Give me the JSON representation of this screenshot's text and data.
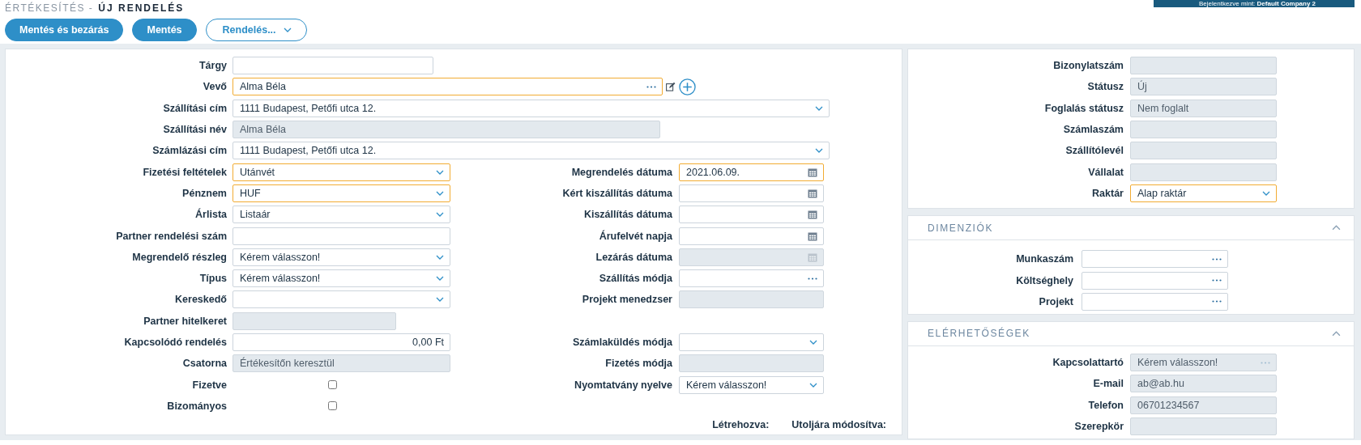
{
  "header": {
    "breadcrumb": "ÉRTÉKESÍTÉS -",
    "title": "ÚJ RENDELÉS",
    "login_banner": "Bejelentkezve mint: **Default Company 2**"
  },
  "buttons": [
    {
      "label": "Mentés és bezárás",
      "kind": "primary"
    },
    {
      "label": "Mentés",
      "kind": "primary"
    },
    {
      "label": "Rendelés...",
      "kind": "menu"
    }
  ],
  "order_form": {
    "top_fields": [
      {
        "label": "Tárgy",
        "kind": "text",
        "disabled": false,
        "highlighted": false,
        "extra_actions": false
      },
      {
        "label": "Vevő",
        "kind": "lookup",
        "value": "Alma Béla",
        "disabled": false,
        "highlighted": true,
        "extra_actions": true
      },
      {
        "label": "Szállítási cím",
        "kind": "select",
        "value": "1111 Budapest, Petőfi utca 12.",
        "disabled": false,
        "highlighted": false,
        "extra_actions": false
      },
      {
        "label": "Szállítási név",
        "kind": "text",
        "value": "Alma Béla",
        "disabled": true,
        "highlighted": false,
        "extra_actions": false
      },
      {
        "label": "Számlázási cím",
        "kind": "select",
        "value": "1111 Budapest, Petőfi utca 12.",
        "disabled": false,
        "highlighted": false,
        "extra_actions": false
      }
    ],
    "rows": [
      {
        "left": {
          "label": "Fizetési feltételek",
          "kind": "select",
          "value": "Utánvét",
          "disabled": false,
          "highlighted": true
        },
        "right": {
          "label": "Megrendelés dátuma",
          "kind": "date",
          "value": "2021.06.09.",
          "disabled": false,
          "highlighted": true
        }
      },
      {
        "left": {
          "label": "Pénznem",
          "kind": "select",
          "value": "HUF",
          "disabled": false,
          "highlighted": true
        },
        "right": {
          "label": "Kért kiszállítás dátuma",
          "kind": "date",
          "disabled": false,
          "highlighted": false
        }
      },
      {
        "left": {
          "label": "Árlista",
          "kind": "select",
          "value": "Listaár",
          "disabled": false,
          "highlighted": false
        },
        "right": {
          "label": "Kiszállítás dátuma",
          "kind": "date",
          "disabled": false,
          "highlighted": false
        }
      },
      {
        "left": {
          "label": "Partner rendelési szám",
          "kind": "text",
          "disabled": false,
          "highlighted": false
        },
        "right": {
          "label": "Árufelvét napja",
          "kind": "date",
          "disabled": false,
          "highlighted": false
        }
      },
      {
        "left": {
          "label": "Megrendelő részleg",
          "kind": "select",
          "value": "Kérem válasszon!",
          "disabled": false,
          "highlighted": false
        },
        "right": {
          "label": "Lezárás dátuma",
          "kind": "date",
          "disabled": true,
          "highlighted": false
        }
      },
      {
        "left": {
          "label": "Típus",
          "kind": "select",
          "value": "Kérem válasszon!",
          "disabled": false,
          "highlighted": false
        },
        "right": {
          "label": "Szállítás módja",
          "kind": "lookup",
          "disabled": false,
          "highlighted": false
        }
      },
      {
        "left": {
          "label": "Kereskedő",
          "kind": "select",
          "disabled": false,
          "highlighted": false
        },
        "right": {
          "label": "Projekt menedzser",
          "kind": "text",
          "disabled": true,
          "highlighted": false
        }
      },
      {
        "left": {
          "label": "Partner hitelkeret",
          "kind": "short",
          "disabled": true,
          "highlighted": false
        }
      },
      {
        "left": {
          "label": "Kapcsolódó rendelés",
          "kind": "amount",
          "value": "0,00 Ft",
          "disabled": false,
          "highlighted": false
        },
        "right": {
          "label": "Számlaküldés módja",
          "kind": "select",
          "disabled": false,
          "highlighted": false
        }
      },
      {
        "left": {
          "label": "Csatorna",
          "kind": "text",
          "value": "Értékesítőn keresztül",
          "disabled": true,
          "highlighted": false
        },
        "right": {
          "label": "Fizetés módja",
          "kind": "text",
          "disabled": true,
          "highlighted": false
        }
      },
      {
        "left": {
          "label": "Fizetve",
          "kind": "checkbox",
          "checked": false,
          "disabled": false,
          "highlighted": false
        },
        "right": {
          "label": "Nyomtatvány nyelve",
          "kind": "select",
          "value": "Kérem válasszon!",
          "disabled": false,
          "highlighted": false
        }
      },
      {
        "left": {
          "label": "Bizományos",
          "kind": "checkbox",
          "checked": false,
          "disabled": false,
          "highlighted": false
        }
      }
    ],
    "footer": [
      "Létrehozva:",
      "Utoljára módosítva:"
    ]
  },
  "document_panel": {
    "fields": [
      {
        "label": "Bizonylatszám",
        "kind": "text",
        "disabled": true,
        "highlighted": false
      },
      {
        "label": "Státusz",
        "kind": "text",
        "value": "Új",
        "disabled": true,
        "highlighted": false
      },
      {
        "label": "Foglalás státusz",
        "kind": "text",
        "value": "Nem foglalt",
        "disabled": true,
        "highlighted": false
      },
      {
        "label": "Számlaszám",
        "kind": "text",
        "disabled": true,
        "highlighted": false
      },
      {
        "label": "Szállítólevél",
        "kind": "text",
        "disabled": true,
        "highlighted": false
      },
      {
        "label": "Vállalat",
        "kind": "text",
        "disabled": true,
        "highlighted": false
      },
      {
        "label": "Raktár",
        "kind": "select",
        "value": "Alap raktár",
        "disabled": false,
        "highlighted": true
      }
    ]
  },
  "sections": [
    {
      "title": "DIMENZIÓK",
      "expanded": true,
      "fields": [
        {
          "label": "Munkaszám",
          "kind": "lookup",
          "disabled": false,
          "highlighted": false
        },
        {
          "label": "Költséghely",
          "kind": "lookup",
          "disabled": false,
          "highlighted": false
        },
        {
          "label": "Projekt",
          "kind": "lookup",
          "disabled": false,
          "highlighted": false
        }
      ]
    },
    {
      "title": "ELÉRHETŐSÉGEK",
      "expanded": true,
      "fields": [
        {
          "label": "Kapcsolattartó",
          "kind": "lookup",
          "value": "Kérem válasszon!",
          "disabled": true,
          "highlighted": false
        },
        {
          "label": "E-mail",
          "kind": "text",
          "value": "ab@ab.hu",
          "disabled": true,
          "highlighted": false
        },
        {
          "label": "Telefon",
          "kind": "text",
          "value": "06701234567",
          "disabled": true,
          "highlighted": false
        },
        {
          "label": "Szerepkör",
          "kind": "text",
          "disabled": true,
          "highlighted": false
        }
      ]
    }
  ]
}
